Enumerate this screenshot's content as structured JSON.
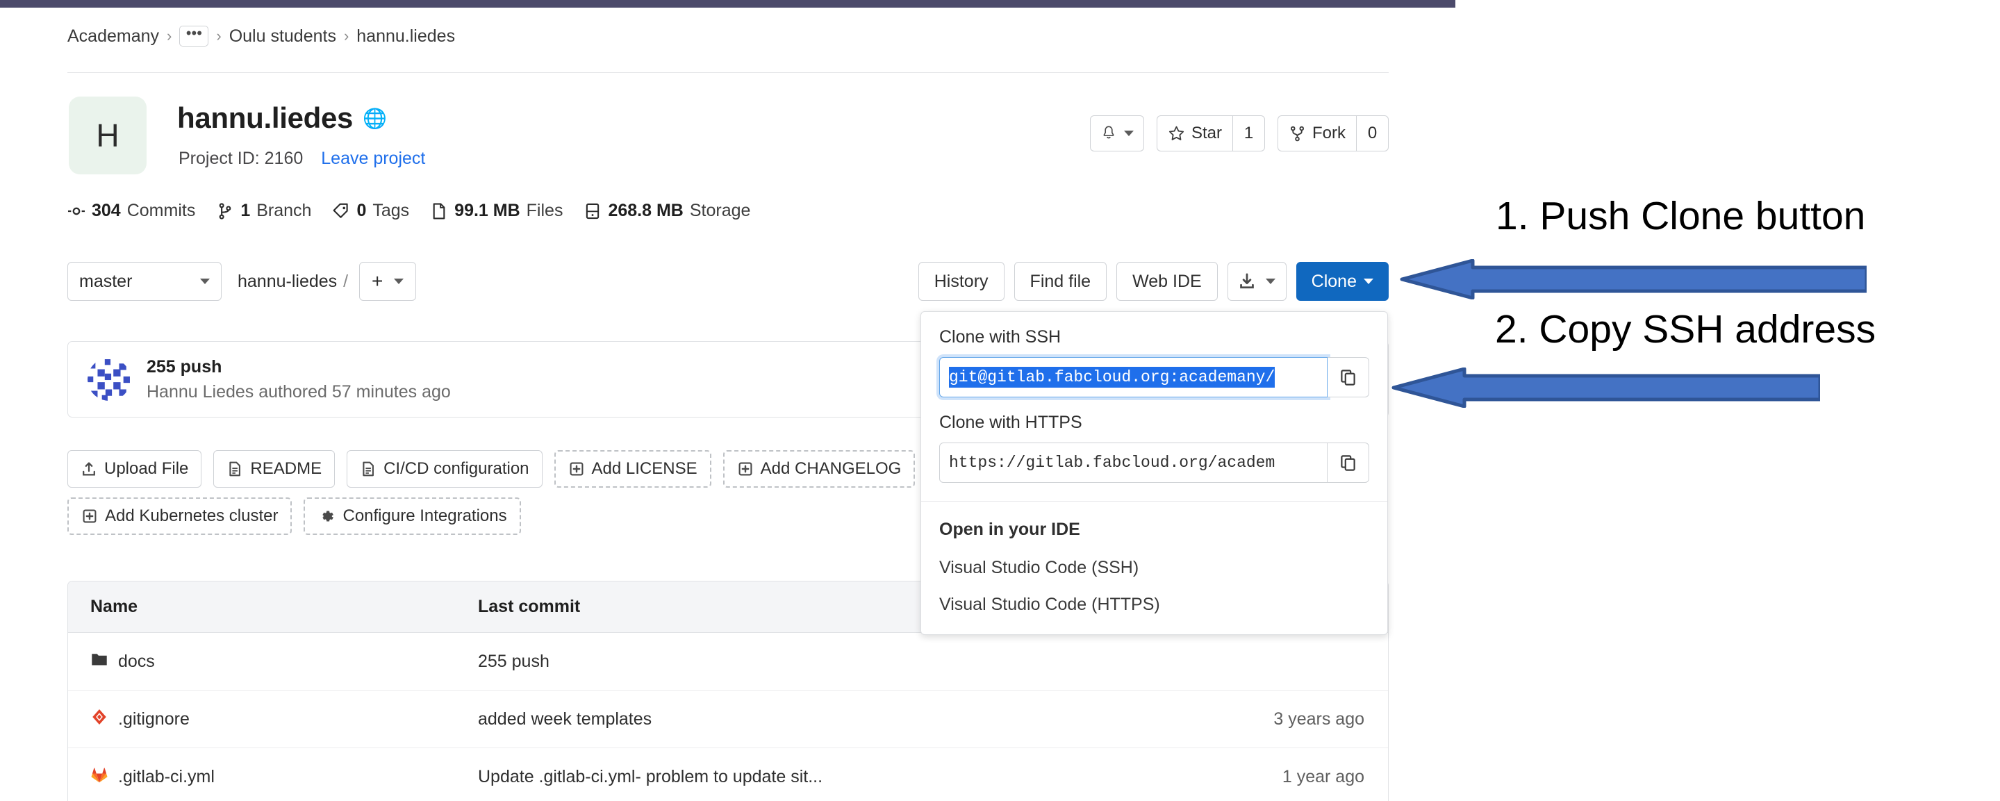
{
  "breadcrumb": {
    "items": [
      "Academany",
      "•••",
      "Oulu students",
      "hannu.liedes"
    ],
    "separator": "›"
  },
  "project": {
    "avatar_letter": "H",
    "title": "hannu.liedes",
    "visibility_icon": "globe-icon",
    "project_id_label": "Project ID: 2160",
    "leave_link": "Leave project"
  },
  "header_actions": {
    "notifications_icon": "bell-icon",
    "star_label": "Star",
    "star_count": "1",
    "fork_label": "Fork",
    "fork_count": "0"
  },
  "stats": [
    {
      "icon": "commit-icon",
      "value": "304",
      "label": "Commits"
    },
    {
      "icon": "branch-icon",
      "value": "1",
      "label": "Branch"
    },
    {
      "icon": "tag-icon",
      "value": "0",
      "label": "Tags"
    },
    {
      "icon": "file-icon",
      "value": "99.1 MB",
      "label": "Files"
    },
    {
      "icon": "storage-icon",
      "value": "268.8 MB",
      "label": "Storage"
    }
  ],
  "toolbar": {
    "branch": "master",
    "path_root": "hannu-liedes",
    "path_slash": "/",
    "plus_label": "+",
    "history_label": "History",
    "find_file_label": "Find file",
    "web_ide_label": "Web IDE",
    "download_icon": "download-icon",
    "clone_label": "Clone"
  },
  "commit": {
    "title": "255 push",
    "meta": "Hannu Liedes authored 57 minutes ago"
  },
  "quick_actions": {
    "row1": [
      {
        "label": "Upload File",
        "icon": "upload-icon",
        "dashed": false
      },
      {
        "label": "README",
        "icon": "doc-icon",
        "dashed": false
      },
      {
        "label": "CI/CD configuration",
        "icon": "doc-icon",
        "dashed": false
      },
      {
        "label": "Add LICENSE",
        "icon": "plus-box-icon",
        "dashed": true
      },
      {
        "label": "Add CHANGELOG",
        "icon": "plus-box-icon",
        "dashed": true
      }
    ],
    "row2": [
      {
        "label": "Add Kubernetes cluster",
        "icon": "plus-box-icon",
        "dashed": true
      },
      {
        "label": "Configure Integrations",
        "icon": "gear-icon",
        "dashed": true
      }
    ]
  },
  "file_table": {
    "columns": [
      "Name",
      "Last commit",
      ""
    ],
    "rows": [
      {
        "name": "docs",
        "icon": "folder-icon",
        "last_commit": "255 push",
        "time": ""
      },
      {
        "name": ".gitignore",
        "icon": "gitignore-icon",
        "last_commit": "added week templates",
        "time": "3 years ago"
      },
      {
        "name": ".gitlab-ci.yml",
        "icon": "gitlab-icon",
        "last_commit": "Update .gitlab-ci.yml- problem to update sit...",
        "time": "1 year ago"
      }
    ]
  },
  "clone_dropdown": {
    "ssh_label": "Clone with SSH",
    "ssh_value": "git@gitlab.fabcloud.org:academany/",
    "https_label": "Clone with HTTPS",
    "https_value": "https://gitlab.fabcloud.org/academ",
    "copy_icon": "clipboard-icon",
    "ide_title": "Open in your IDE",
    "ide_items": [
      "Visual Studio Code (SSH)",
      "Visual Studio Code (HTTPS)"
    ]
  },
  "annotations": [
    {
      "text": "1. Push Clone button"
    },
    {
      "text": "2. Copy SSH address"
    }
  ],
  "colors": {
    "clone_button": "#1068bf",
    "link": "#1f6feb",
    "selection": "#1f6feb",
    "arrow_fill": "#4472c4",
    "arrow_stroke": "#2f5597",
    "top_strip": "#4c4a6b"
  }
}
